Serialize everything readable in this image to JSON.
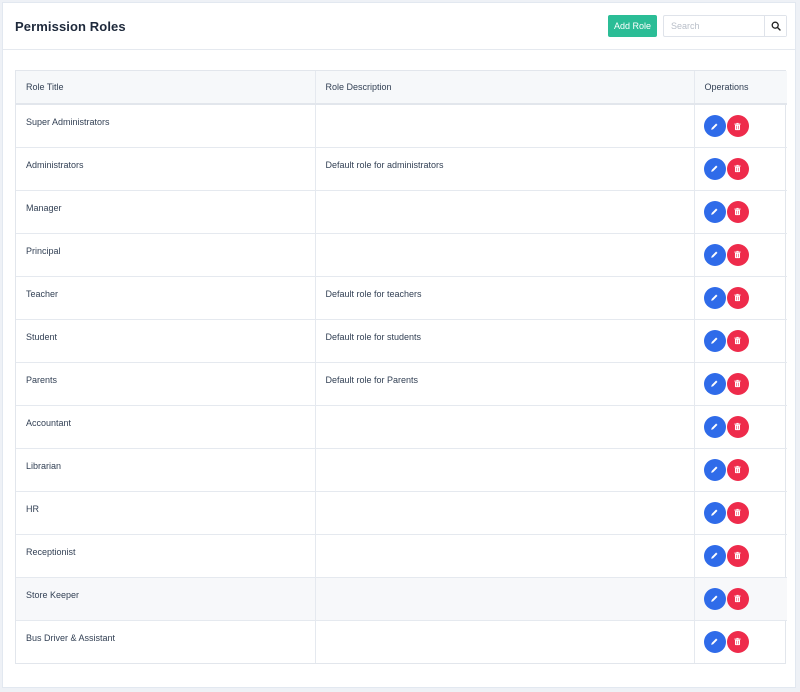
{
  "header": {
    "title": "Permission Roles",
    "add_label": "Add Role",
    "search_placeholder": "Search"
  },
  "table": {
    "columns": [
      "Role Title",
      "Role Description",
      "Operations"
    ],
    "rows": [
      {
        "title": "Super Administrators",
        "description": ""
      },
      {
        "title": "Administrators",
        "description": "Default role for administrators"
      },
      {
        "title": "Manager",
        "description": ""
      },
      {
        "title": "Principal",
        "description": ""
      },
      {
        "title": "Teacher",
        "description": "Default role for teachers"
      },
      {
        "title": "Student",
        "description": "Default role for students"
      },
      {
        "title": "Parents",
        "description": "Default role for Parents"
      },
      {
        "title": "Accountant",
        "description": ""
      },
      {
        "title": "Librarian",
        "description": ""
      },
      {
        "title": "HR",
        "description": ""
      },
      {
        "title": "Receptionist",
        "description": ""
      },
      {
        "title": "Store Keeper",
        "description": ""
      },
      {
        "title": "Bus Driver & Assistant",
        "description": ""
      }
    ]
  },
  "colors": {
    "add_button": "#2bbd96",
    "edit_button": "#2f6be9",
    "delete_button": "#ee2b4b"
  },
  "icons": {
    "search": "search-icon",
    "edit": "pencil-icon",
    "delete": "trash-icon"
  }
}
